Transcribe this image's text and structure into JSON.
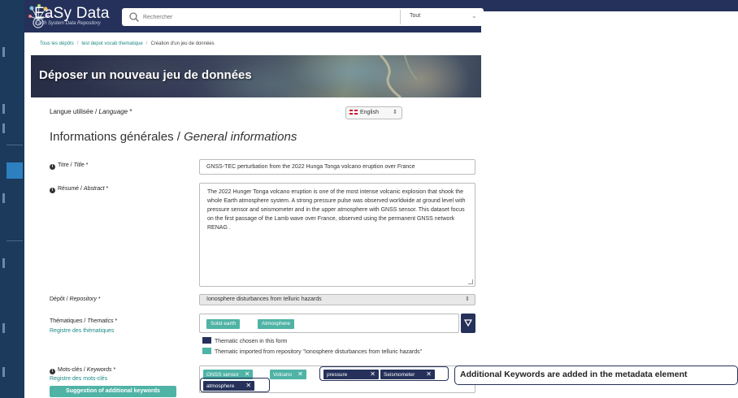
{
  "app": {
    "name": "EaSy Data",
    "tagline": "Earth System Data Repository"
  },
  "search": {
    "placeholder": "Rechercher",
    "scope": "Tout"
  },
  "breadcrumb": {
    "items": [
      "Tous les dépôts",
      "test depot vocab thematique",
      "Création d'un jeu de données"
    ]
  },
  "banner": {
    "title": "Déposer un nouveau jeu de données"
  },
  "form": {
    "language": {
      "label": "Langue utilisée / ",
      "label_en": "Language",
      "required": " *",
      "value": "English"
    },
    "section_title": "Informations générales / ",
    "section_title_en": "General informations",
    "title_field": {
      "label": "Titre / ",
      "label_en": "Title",
      "required": " *",
      "value": "GNSS-TEC perturbation from the 2022 Hunga Tonga volcano eruption over France"
    },
    "abstract_field": {
      "label": "Résumé / ",
      "label_en": "Abstract",
      "required": " *",
      "value": "The 2022 Hunger Tonga volcano eruption is one of the most intense volcanic explosion that shook the whole Earth atmosphere system. A strong pressure pulse was observed worldwide at ground level with pressure sensor and seismometer and in the upper atmosphere with GNSS sensor. This dataset focus on the first passage of the Lamb wave over France, observed using the permanent GNSS network RENAG ."
    },
    "repository_field": {
      "label": "Dépôt / ",
      "label_en": "Repository",
      "required": " *",
      "value": "Ionosphere disturbances from telluric hazards"
    },
    "thematics_field": {
      "label": "Thématiques / ",
      "label_en": "Thematics",
      "required": " *",
      "registry_link": "Registre des thématiques",
      "tags": [
        "Solid earth",
        "Atmosphere"
      ],
      "legend_chosen": "Thematic chosen in this form",
      "legend_imported": "Thematic imported from repository \"Ionosphere disturbances from telluric hazards\""
    },
    "keywords_field": {
      "label": "Mots-clés / ",
      "label_en": "Keywords",
      "required": " *",
      "registry_link": "Registre des mots-clés",
      "suggest_button": "Suggestion of additional keywords",
      "tags_imported": [
        "GNSS sensor",
        "Volcano"
      ],
      "tags_added": [
        "pressure",
        "Seismometer",
        "atmosphere"
      ],
      "remove_glyph": "✕"
    }
  },
  "annotation": "Additional Keywords are added in the metadata element",
  "colors": {
    "header": "#25315a",
    "teal": "#4fb3a6",
    "navy": "#25315a",
    "link": "#1a8a84"
  },
  "icons": {
    "logo": "easy-data-logo-icon",
    "search": "search-icon",
    "dropdown": "dropdown-triangle-icon",
    "info": "info-circle-icon"
  }
}
